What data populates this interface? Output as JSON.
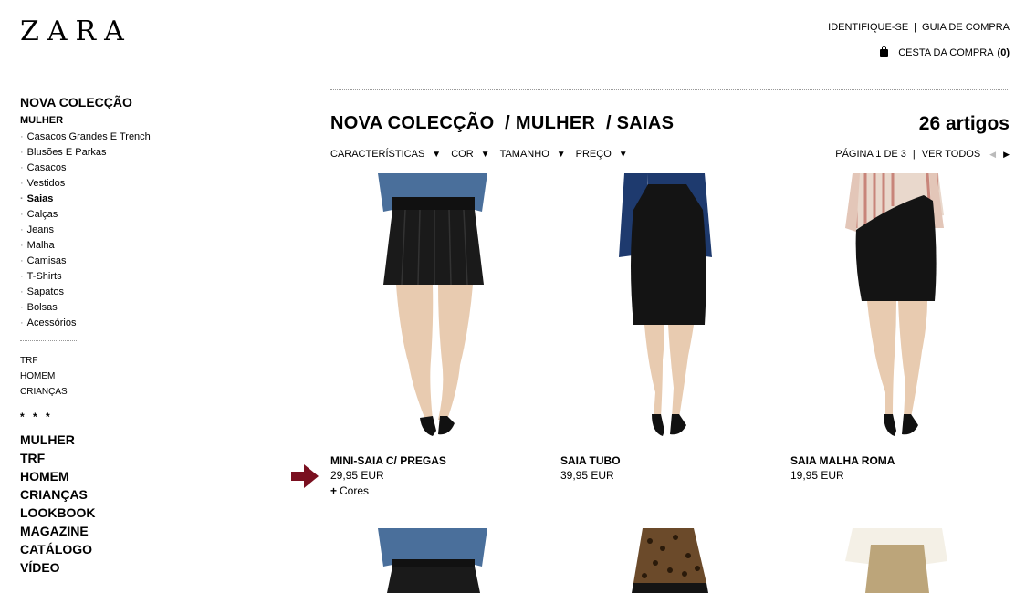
{
  "header": {
    "logo": "ZARA",
    "links": [
      "IDENTIFIQUE-SE",
      "GUIA DE COMPRA"
    ],
    "cart_label": "CESTA DA COMPRA",
    "cart_count": "(0)",
    "cart_icon": "shopping-bag-icon"
  },
  "sidebar": {
    "section_title": "NOVA COLECÇÃO",
    "subsection": "MULHER",
    "items": [
      "Casacos Grandes E Trench",
      "Blusões E Parkas",
      "Casacos",
      "Vestidos",
      "Saias",
      "Calças",
      "Jeans",
      "Malha",
      "Camisas",
      "T-Shirts",
      "Sapatos",
      "Bolsas",
      "Acessórios"
    ],
    "active_item": "Saias",
    "small_links": [
      "TRF",
      "HOMEM",
      "CRIANÇAS"
    ],
    "stars": "* * *",
    "main_links": [
      "MULHER",
      "TRF",
      "HOMEM",
      "CRIANÇAS",
      "LOOKBOOK",
      "MAGAZINE",
      "CATÁLOGO",
      "VÍDEO"
    ]
  },
  "main": {
    "breadcrumb": "NOVA COLECÇÃO  / MULHER  / SAIAS",
    "count": "26 artigos",
    "filters": [
      "CARACTERÍSTICAS",
      "COR",
      "TAMANHO",
      "PREÇO"
    ],
    "pager": {
      "page_text": "PÁGINA 1 DE 3",
      "view_all": "VER TODOS",
      "prev_icon": "triangle-left-icon",
      "next_icon": "triangle-right-icon"
    },
    "products": [
      {
        "name": "MINI-SAIA C/ PREGAS",
        "price": "29,95 EUR",
        "colors": "Cores"
      },
      {
        "name": "SAIA TUBO",
        "price": "39,95 EUR"
      },
      {
        "name": "SAIA MALHA ROMA",
        "price": "19,95 EUR"
      }
    ]
  },
  "colors": {
    "arrow": "#7a1020",
    "skin": "#e8cbb0",
    "denim": "#4a6f9b",
    "navy": "#1e3a6e",
    "stripe": "#c8857a",
    "leopard": "#6b4a2a",
    "beige": "#bca57a"
  }
}
